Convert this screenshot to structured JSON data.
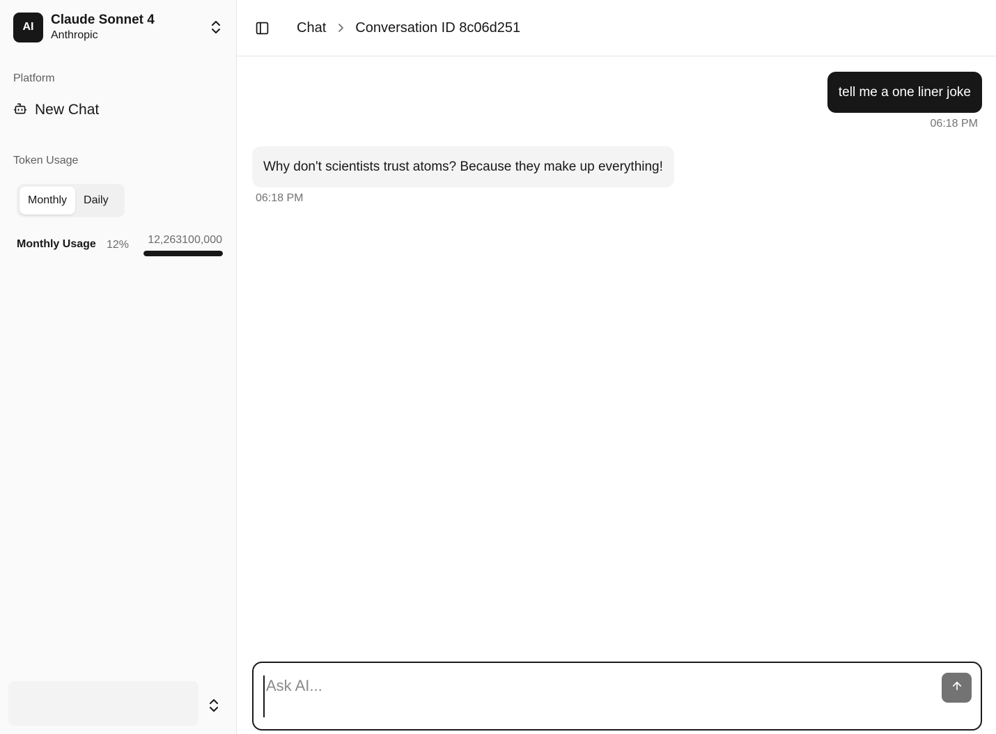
{
  "sidebar": {
    "avatar_text": "AI",
    "model_name": "Claude Sonnet 4",
    "model_org": "Anthropic",
    "platform_label": "Platform",
    "new_chat_label": "New Chat",
    "token_usage_label": "Token Usage",
    "toggle": {
      "monthly": "Monthly",
      "daily": "Daily",
      "selected": "Monthly"
    },
    "usage": {
      "label": "Monthly Usage",
      "percent_text": "12%",
      "count_text": "12,263100,000",
      "fill_percent": 100
    }
  },
  "header": {
    "crumb_root": "Chat",
    "crumb_current": "Conversation ID 8c06d251"
  },
  "messages": [
    {
      "role": "user",
      "text": "tell me a one liner joke",
      "time": "06:18 PM"
    },
    {
      "role": "assistant",
      "text": "Why don't scientists trust atoms? Because they make up everything!",
      "time": "06:18 PM"
    }
  ],
  "composer": {
    "placeholder": "Ask AI..."
  },
  "colors": {
    "primary": "#171717",
    "sidebar_bg": "#fafafa",
    "send_button": "#737373"
  },
  "icons": [
    "chevrons-up-down-icon",
    "bot-icon",
    "sidebar-panel-icon",
    "chevron-right-icon",
    "arrow-up-icon"
  ]
}
